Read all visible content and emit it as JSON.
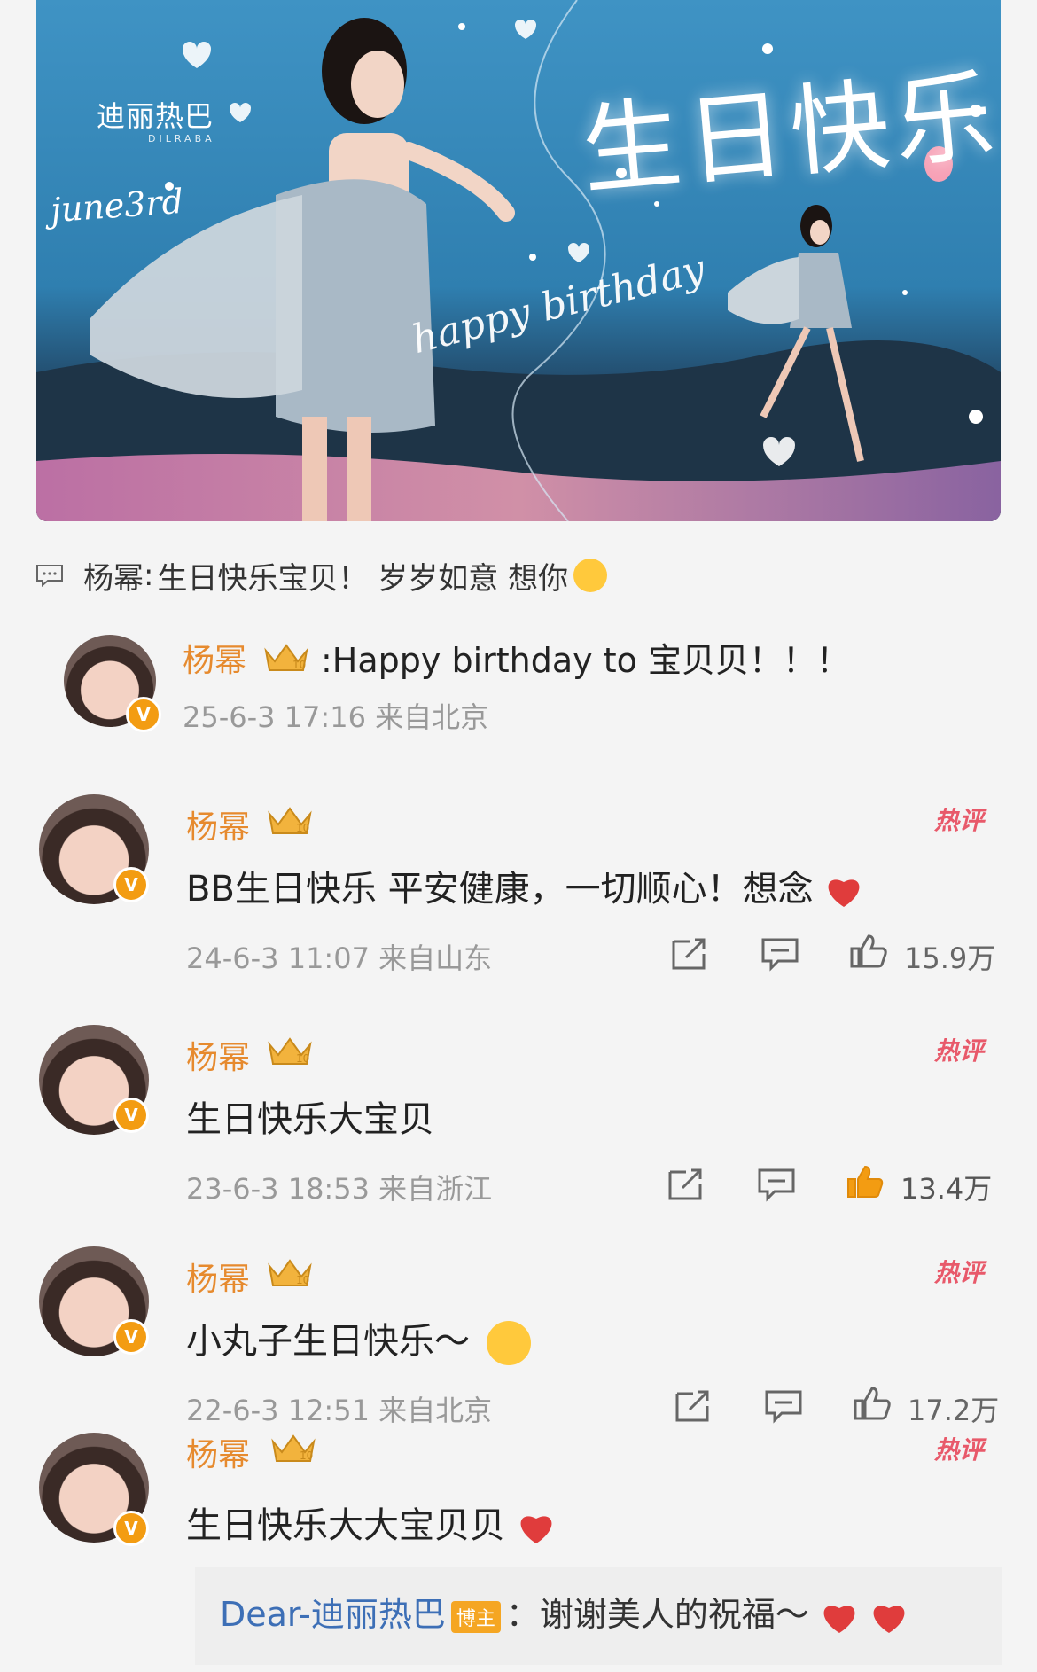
{
  "banner": {
    "brand_cn": "迪丽热巴",
    "brand_en": "DILRABA",
    "date_script": "june3rd",
    "title": "生日快乐",
    "subtitle": "happy birthday"
  },
  "quote": {
    "author": "杨幂",
    "text": "生日快乐宝贝！ 岁岁如意 想你"
  },
  "comments": [
    {
      "user": "杨幂",
      "text": ":Happy birthday to 宝贝贝！！！",
      "meta": "25-6-3 17:16 来自北京"
    },
    {
      "user": "杨幂",
      "hot": "热评",
      "text": "BB生日快乐 平安健康，一切顺心！想念",
      "meta": "24-6-3 11:07 来自山东",
      "likes": "15.9万"
    },
    {
      "user": "杨幂",
      "hot": "热评",
      "text": "生日快乐大宝贝",
      "meta": "23-6-3 18:53 来自浙江",
      "likes": "13.4万"
    },
    {
      "user": "杨幂",
      "hot": "热评",
      "text": "小丸子生日快乐～",
      "meta": "22-6-3 12:51 来自北京",
      "likes": "17.2万"
    },
    {
      "user": "杨幂",
      "hot": "热评",
      "text": "生日快乐大大宝贝贝"
    }
  ],
  "reply": {
    "name": "Dear-迪丽热巴",
    "badge": "博主",
    "text": "：谢谢美人的祝福～"
  },
  "colors": {
    "username": "#e68a2e",
    "hot": "#e8596a",
    "like_active": "#f39c12",
    "reply_name": "#3d6fb6"
  }
}
